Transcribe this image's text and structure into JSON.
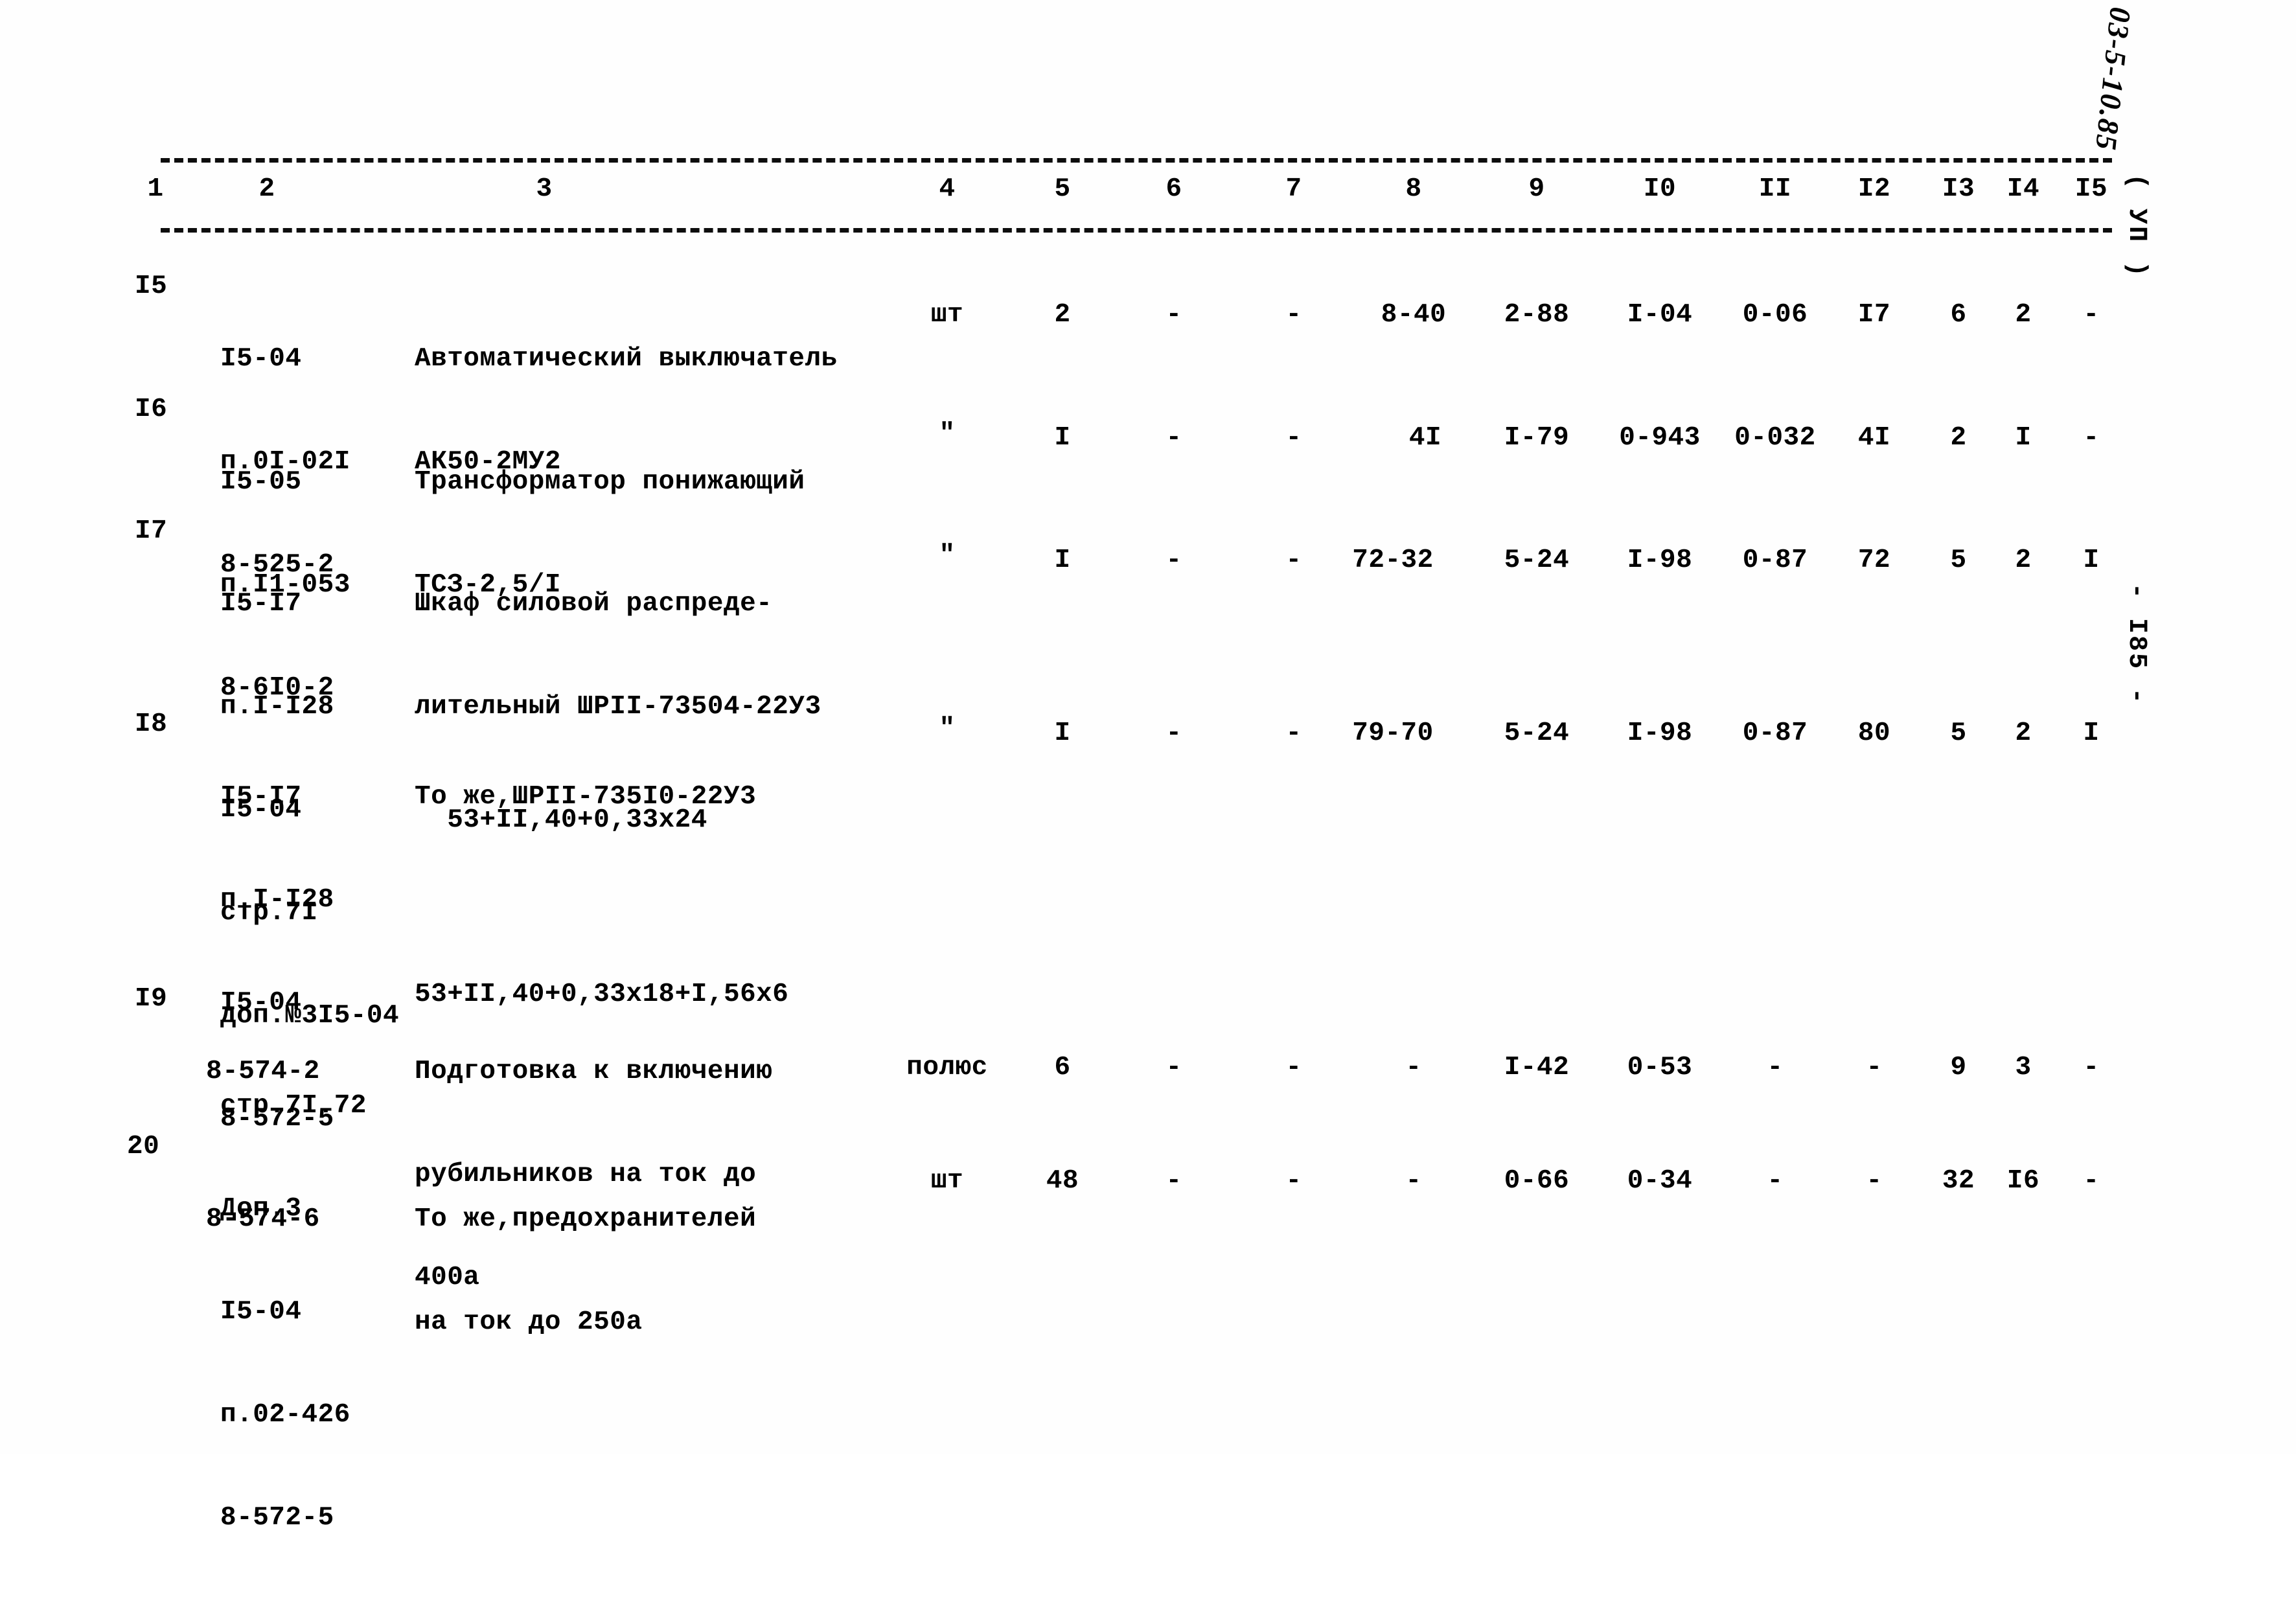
{
  "document": {
    "type": "scanned-estimate-table",
    "margin_notes": {
      "handwritten_code": "03-5-10.85",
      "section_mark": "( УП )",
      "page_number": "- I85 -"
    }
  },
  "table": {
    "column_headers": [
      "1",
      "2",
      "3",
      "4",
      "5",
      "6",
      "7",
      "8",
      "9",
      "I0",
      "II",
      "I2",
      "I3",
      "I4",
      "I5"
    ],
    "rows": [
      {
        "num": "I5",
        "codes": [
          "I5-04",
          "п.0I-02I",
          "8-525-2"
        ],
        "description": [
          "Автоматический выключатель",
          "АК50-2МУ2"
        ],
        "unit": "шт",
        "c5": "2",
        "c6": "-",
        "c7": "-",
        "c8": "8-40",
        "c9": "2-88",
        "c10": "I-04",
        "c11": "0-06",
        "c12": "I7",
        "c13": "6",
        "c14": "2",
        "c15": "-"
      },
      {
        "num": "I6",
        "codes": [
          "I5-05",
          "п.I1-053",
          "8-6I0-2"
        ],
        "description": [
          "Трансформатор понижающий",
          "ТСЗ-2,5/I"
        ],
        "unit": "\"",
        "c5": "I",
        "c6": "-",
        "c7": "-",
        "c8": "4I",
        "c9": "I-79",
        "c10": "0-943",
        "c11": "0-032",
        "c12": "4I",
        "c13": "2",
        "c14": "I",
        "c15": "-"
      },
      {
        "num": "I7",
        "codes": [
          "I5-I7",
          "п.I-I28",
          "I5-04",
          "стр.7I",
          "доп.№3I5-04",
          "8-572-5"
        ],
        "description": [
          "Шкаф силовой распреде-",
          "лительный ШРII-73504-22У3",
          "  53+II,40+0,33х24"
        ],
        "unit": "\"",
        "c5": "I",
        "c6": "-",
        "c7": "-",
        "c8": "72-32",
        "c9": "5-24",
        "c10": "I-98",
        "c11": "0-87",
        "c12": "72",
        "c13": "5",
        "c14": "2",
        "c15": "I"
      },
      {
        "num": "I8",
        "codes": [
          "I5-I7",
          "п.I-I28",
          "I5-04",
          "стр.7I.72",
          "Доп.3",
          "I5-04",
          "п.02-426",
          "8-572-5"
        ],
        "description": [
          "То же,ШРII-735I0-22У3",
          "",
          "53+II,40+0,33х18+I,56х6"
        ],
        "unit": "\"",
        "c5": "I",
        "c6": "-",
        "c7": "-",
        "c8": "79-70",
        "c9": "5-24",
        "c10": "I-98",
        "c11": "0-87",
        "c12": "80",
        "c13": "5",
        "c14": "2",
        "c15": "I"
      },
      {
        "num": "I9",
        "codes": [
          "8-574-2"
        ],
        "description": [
          "Подготовка к включению",
          "рубильников на ток до",
          "400а"
        ],
        "unit": "полюс",
        "c5": "6",
        "c6": "-",
        "c7": "-",
        "c8": "-",
        "c9": "I-42",
        "c10": "0-53",
        "c11": "-",
        "c12": "-",
        "c13": "9",
        "c14": "3",
        "c15": "-"
      },
      {
        "num": "20",
        "codes": [
          "8-574-6"
        ],
        "description": [
          "То же,предохранителей",
          "на ток до 250а"
        ],
        "unit": "шт",
        "c5": "48",
        "c6": "-",
        "c7": "-",
        "c8": "-",
        "c9": "0-66",
        "c10": "0-34",
        "c11": "-",
        "c12": "-",
        "c13": "32",
        "c14": "I6",
        "c15": "-"
      }
    ]
  }
}
